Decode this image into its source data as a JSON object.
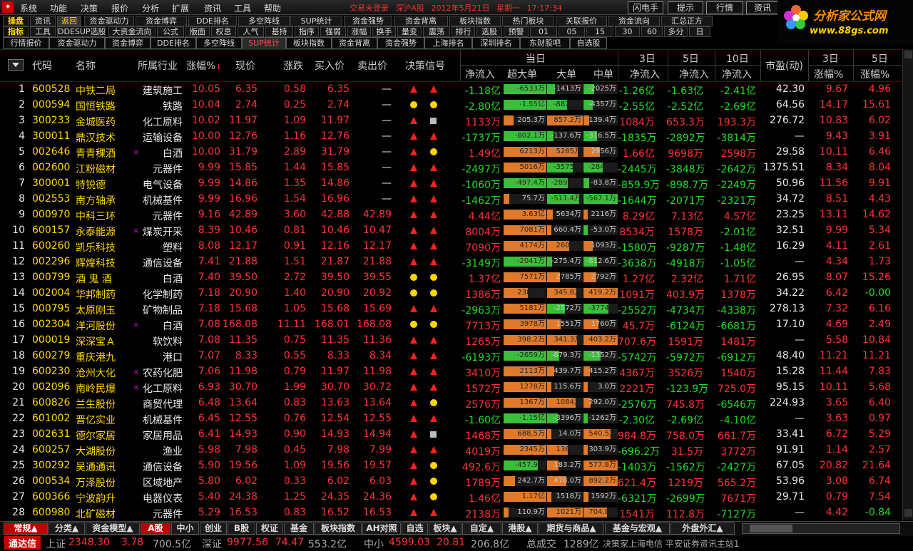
{
  "menu": [
    "系统",
    "功能",
    "决策",
    "报价",
    "分析",
    "扩展",
    "资讯",
    "工具",
    "帮助"
  ],
  "status": {
    "login": "交易未登录",
    "market": "深沪A股",
    "date": "2012年5月21日",
    "weekday": "星期一",
    "time": "17:17:34"
  },
  "top_buttons": [
    "闪电手",
    "提示",
    "行情",
    "资讯"
  ],
  "brand": {
    "name": "分析家公式网",
    "url": "www.88gs.com"
  },
  "toolbar_left": [
    [
      "操盘",
      "资讯",
      "返回"
    ],
    [
      "指标",
      "工具",
      "DDESUP选股"
    ]
  ],
  "toolbar_row1": [
    "资金驱动力",
    "资金博弈",
    "DDE排名",
    "多空阵线",
    "SUP统计",
    "资金强势",
    "资金背离",
    "板块指数",
    "热门板块",
    "关联报价",
    "资金流向",
    "汇总正方"
  ],
  "toolbar_row2": [
    "大资金流向",
    "公式",
    "版面",
    "权息",
    "人气",
    "基持",
    "指序",
    "强弱",
    "涨幅",
    "换手",
    "量变",
    "震荡",
    "排行",
    "选股",
    "预警",
    "01",
    "05",
    "15",
    "30",
    "60",
    "多分",
    "日"
  ],
  "tabs": [
    "行情报价",
    "资金驱动力",
    "资金博弈",
    "DDE排名",
    "多空阵线",
    "SUP统计",
    "板块指数",
    "资金背离",
    "资金强势",
    "上海排名",
    "深圳排名",
    "东财股吧",
    "自选股"
  ],
  "active_tab": "SUP统计",
  "header": {
    "code": "代码",
    "name": "名称",
    "industry": "所属行业",
    "chg_pct": "涨幅%",
    "price": "现价",
    "chg": "涨跌",
    "bid": "买入价",
    "ask": "卖出价",
    "signal": "决策信号",
    "today": "当日",
    "net": "净流入",
    "xl": "超大单",
    "l": "大单",
    "m": "中单",
    "d3": "3日",
    "d5": "5日",
    "d10": "10日",
    "pe": "市盈(动)",
    "d3b": "3日",
    "d5b": "5日",
    "chgpct": "涨幅%"
  },
  "rows": [
    {
      "n": "1",
      "code": "600528",
      "name": "中铁二局",
      "ind": "建筑施工",
      "x": "",
      "pct": "10.05",
      "price": "6.35",
      "chg": "0.58",
      "bid": "6.35",
      "ask": "—",
      "s1": "tri",
      "s2": "tri",
      "net": "-1.18亿",
      "xl": "-6533万",
      "l": "-1413万",
      "m": "-2025万",
      "d3": "-1.26亿",
      "d5": "-1.63亿",
      "d10": "-2.41亿",
      "pe": "42.30",
      "p3": "9.67",
      "p5": "4.96"
    },
    {
      "n": "2",
      "code": "000594",
      "name": "国恒铁路",
      "ind": "铁路",
      "x": "",
      "pct": "10.04",
      "price": "2.74",
      "chg": "0.25",
      "bid": "2.74",
      "ask": "—",
      "s1": "dot",
      "s2": "dot",
      "net": "-2.80亿",
      "xl": "-1.55亿",
      "l": "-8821万",
      "m": "-4357万",
      "d3": "-2.55亿",
      "d5": "-2.52亿",
      "d10": "-2.69亿",
      "pe": "64.56",
      "p3": "14.17",
      "p5": "15.61"
    },
    {
      "n": "3",
      "code": "300233",
      "name": "金城医药",
      "ind": "化工原料",
      "x": "",
      "pct": "10.02",
      "price": "11.97",
      "chg": "1.09",
      "bid": "11.97",
      "ask": "—",
      "s1": "tri",
      "s2": "sq",
      "net": "1133万",
      "xl": "205.3万",
      "l": "857.2万",
      "m": "139.4万",
      "d3": "1084万",
      "d5": "653.3万",
      "d10": "193.3万",
      "pe": "276.72",
      "p3": "10.83",
      "p5": "6.02"
    },
    {
      "n": "4",
      "code": "300011",
      "name": "鼎汉技术",
      "ind": "运输设备",
      "x": "",
      "pct": "10.00",
      "price": "12.76",
      "chg": "1.16",
      "bid": "12.76",
      "ask": "—",
      "s1": "tri",
      "s2": "tri",
      "net": "-1737万",
      "xl": "-802.1万",
      "l": "-137.6万",
      "m": "-316.5万",
      "d3": "-1835万",
      "d5": "-2892万",
      "d10": "-3814万",
      "pe": "—",
      "p3": "9.43",
      "p5": "3.91"
    },
    {
      "n": "5",
      "code": "002646",
      "name": "青青稞酒",
      "ind": "白酒",
      "x": "×",
      "pct": "10.00",
      "price": "31.79",
      "chg": "2.89",
      "bid": "31.79",
      "ask": "—",
      "s1": "tri",
      "s2": "dot",
      "net": "1.49亿",
      "xl": "6213万",
      "l": "5285万",
      "m": "2956万",
      "d3": "1.66亿",
      "d5": "9698万",
      "d10": "2598万",
      "pe": "29.58",
      "p3": "10.11",
      "p5": "6.46"
    },
    {
      "n": "6",
      "code": "002600",
      "name": "江粉磁材",
      "ind": "元器件",
      "x": "",
      "pct": "9.99",
      "price": "15.85",
      "chg": "1.44",
      "bid": "15.85",
      "ask": "—",
      "s1": "tri",
      "s2": "tri",
      "net": "-2497万",
      "xl": "5016万",
      "l": "-3575万",
      "m": "-2840万",
      "d3": "-2445万",
      "d5": "-3848万",
      "d10": "-2642万",
      "pe": "1375.51",
      "p3": "8.34",
      "p5": "8.04"
    },
    {
      "n": "7",
      "code": "300001",
      "name": "特锐德",
      "ind": "电气设备",
      "x": "",
      "pct": "9.99",
      "price": "14.86",
      "chg": "1.35",
      "bid": "14.86",
      "ask": "—",
      "s1": "tri",
      "s2": "tri",
      "net": "-1060万",
      "xl": "-497.4万",
      "l": "-289.3万",
      "m": "-83.8万",
      "d3": "-859.9万",
      "d5": "-898.7万",
      "d10": "-2249万",
      "pe": "50.96",
      "p3": "11.56",
      "p5": "9.91"
    },
    {
      "n": "8",
      "code": "002553",
      "name": "南方轴承",
      "ind": "机械基件",
      "x": "",
      "pct": "9.99",
      "price": "16.96",
      "chg": "1.54",
      "bid": "16.96",
      "ask": "—",
      "s1": "tri",
      "s2": "tri",
      "net": "-1462万",
      "xl": "75.7万",
      "l": "-511.4万",
      "m": "-567.1万",
      "d3": "-1644万",
      "d5": "-2071万",
      "d10": "-2321万",
      "pe": "34.72",
      "p3": "8.51",
      "p5": "4.43"
    },
    {
      "n": "9",
      "code": "000970",
      "name": "中科三环",
      "ind": "元器件",
      "x": "",
      "pct": "9.16",
      "price": "42.89",
      "chg": "3.60",
      "bid": "42.88",
      "ask": "42.89",
      "s1": "tri",
      "s2": "tri",
      "net": "4.44亿",
      "xl": "3.63亿",
      "l": "5634万",
      "m": "2116万",
      "d3": "8.29亿",
      "d5": "7.13亿",
      "d10": "4.57亿",
      "pe": "23.25",
      "p3": "13.11",
      "p5": "14.62"
    },
    {
      "n": "10",
      "code": "600157",
      "name": "永泰能源",
      "ind": "煤炭开采",
      "x": "×",
      "pct": "8.39",
      "price": "10.46",
      "chg": "0.81",
      "bid": "10.46",
      "ask": "10.47",
      "s1": "tri",
      "s2": "tri",
      "net": "8004万",
      "xl": "7081万",
      "l": "660.4万",
      "m": "-53.0万",
      "d3": "8534万",
      "d5": "1578万",
      "d10": "-2.01亿",
      "pe": "32.51",
      "p3": "9.99",
      "p5": "5.34"
    },
    {
      "n": "11",
      "code": "600260",
      "name": "凯乐科技",
      "ind": "塑料",
      "x": "",
      "pct": "8.08",
      "price": "12.17",
      "chg": "0.91",
      "bid": "12.16",
      "ask": "12.17",
      "s1": "tri",
      "s2": "tri",
      "net": "7090万",
      "xl": "4174万",
      "l": "2600万",
      "m": "1093万",
      "d3": "-1580万",
      "d5": "-9287万",
      "d10": "-1.48亿",
      "pe": "16.29",
      "p3": "4.11",
      "p5": "2.61"
    },
    {
      "n": "12",
      "code": "002296",
      "name": "辉煌科技",
      "ind": "通信设备",
      "x": "",
      "pct": "7.41",
      "price": "21.88",
      "chg": "1.51",
      "bid": "21.87",
      "ask": "21.88",
      "s1": "tri",
      "s2": "tri",
      "net": "-3149万",
      "xl": "-2041万",
      "l": "-275.4万",
      "m": "-812.6万",
      "d3": "-3638万",
      "d5": "-4918万",
      "d10": "-1.05亿",
      "pe": "—",
      "p3": "4.34",
      "p5": "1.73"
    },
    {
      "n": "13",
      "code": "000799",
      "name": "酒 鬼 酒",
      "ind": "白酒",
      "x": "",
      "pct": "7.40",
      "price": "39.50",
      "chg": "2.72",
      "bid": "39.50",
      "ask": "39.55",
      "s1": "dot",
      "s2": "dot",
      "net": "1.37亿",
      "xl": "7571万",
      "l": "2785万",
      "m": "2792万",
      "d3": "1.27亿",
      "d5": "2.32亿",
      "d10": "1.71亿",
      "pe": "26.95",
      "p3": "8.07",
      "p5": "15.26"
    },
    {
      "n": "14",
      "code": "002004",
      "name": "华邦制药",
      "ind": "化学制药",
      "x": "",
      "pct": "7.18",
      "price": "20.90",
      "chg": "1.40",
      "bid": "20.90",
      "ask": "20.92",
      "s1": "dot",
      "s2": "dot",
      "net": "1386万",
      "xl": "238.9万",
      "l": "345.8万",
      "m": "419.2万",
      "d3": "1091万",
      "d5": "403.9万",
      "d10": "1378万",
      "pe": "34.22",
      "p3": "6.42",
      "p5": "-0.00"
    },
    {
      "n": "15",
      "code": "000795",
      "name": "太原刚玉",
      "ind": "矿物制品",
      "x": "",
      "pct": "7.18",
      "price": "15.68",
      "chg": "1.05",
      "bid": "15.68",
      "ask": "15.69",
      "s1": "tri",
      "s2": "tri",
      "net": "-2963万",
      "xl": "5181万",
      "l": "-2572万",
      "m": "-3774万",
      "d3": "-2552万",
      "d5": "-4734万",
      "d10": "-4338万",
      "pe": "278.13",
      "p3": "7.32",
      "p5": "6.16"
    },
    {
      "n": "16",
      "code": "002304",
      "name": "洋河股份",
      "ind": "白酒",
      "x": "×",
      "pct": "7.08",
      "price": "168.08",
      "chg": "11.11",
      "bid": "168.01",
      "ask": "168.08",
      "s1": "dot",
      "s2": "dot",
      "net": "7713万",
      "xl": "3978万",
      "l": "1551万",
      "m": "1760万",
      "d3": "45.7万",
      "d5": "-6124万",
      "d10": "-6681万",
      "pe": "17.10",
      "p3": "4.69",
      "p5": "2.49"
    },
    {
      "n": "17",
      "code": "000019",
      "name": "深深宝Ａ",
      "ind": "软饮料",
      "x": "",
      "pct": "7.08",
      "price": "11.35",
      "chg": "0.75",
      "bid": "11.35",
      "ask": "11.36",
      "s1": "tri",
      "s2": "tri",
      "net": "1265万",
      "xl": "398.2万",
      "l": "341.3万",
      "m": "403.2万",
      "d3": "707.6万",
      "d5": "1591万",
      "d10": "1481万",
      "pe": "—",
      "p3": "5.58",
      "p5": "10.84"
    },
    {
      "n": "18",
      "code": "600279",
      "name": "重庆港九",
      "ind": "港口",
      "x": "",
      "pct": "7.07",
      "price": "8.33",
      "chg": "0.55",
      "bid": "8.33",
      "ask": "8.34",
      "s1": "tri",
      "s2": "tri",
      "net": "-6193万",
      "xl": "-2659万",
      "l": "-879.3万",
      "m": "-1352万",
      "d3": "-5742万",
      "d5": "-5972万",
      "d10": "-6912万",
      "pe": "48.40",
      "p3": "11.21",
      "p5": "11.21"
    },
    {
      "n": "19",
      "code": "600230",
      "name": "沧州大化",
      "ind": "农药化肥",
      "x": "×",
      "pct": "7.06",
      "price": "11.98",
      "chg": "0.79",
      "bid": "11.97",
      "ask": "11.98",
      "s1": "tri",
      "s2": "tri",
      "net": "3410万",
      "xl": "2113万",
      "l": "439.7万",
      "m": "415.2万",
      "d3": "4367万",
      "d5": "3526万",
      "d10": "1540万",
      "pe": "15.28",
      "p3": "11.44",
      "p5": "7.83"
    },
    {
      "n": "20",
      "code": "002096",
      "name": "南岭民爆",
      "ind": "化工原料",
      "x": "×",
      "pct": "6.93",
      "price": "30.70",
      "chg": "1.99",
      "bid": "30.70",
      "ask": "30.72",
      "s1": "tri",
      "s2": "tri",
      "net": "1572万",
      "xl": "1278万",
      "l": "115.6万",
      "m": "3.0万",
      "d3": "2221万",
      "d5": "-123.9万",
      "d10": "725.0万",
      "pe": "95.15",
      "p3": "10.11",
      "p5": "5.68"
    },
    {
      "n": "21",
      "code": "600826",
      "name": "兰生股份",
      "ind": "商贸代理",
      "x": "",
      "pct": "6.48",
      "price": "13.64",
      "chg": "0.83",
      "bid": "13.63",
      "ask": "13.64",
      "s1": "tri",
      "s2": "dot",
      "net": "2576万",
      "xl": "1367万",
      "l": "1084万",
      "m": "292.0万",
      "d3": "-2576万",
      "d5": "745.8万",
      "d10": "-6546万",
      "pe": "224.93",
      "p3": "3.65",
      "p5": "6.40"
    },
    {
      "n": "22",
      "code": "601002",
      "name": "晋亿实业",
      "ind": "机械基件",
      "x": "",
      "pct": "6.45",
      "price": "12.55",
      "chg": "0.76",
      "bid": "12.54",
      "ask": "12.55",
      "s1": "tri",
      "s2": "tri",
      "net": "-1.60亿",
      "xl": "-1.15亿",
      "l": "-3396万",
      "m": "-1262万",
      "d3": "-2.30亿",
      "d5": "-2.69亿",
      "d10": "-4.10亿",
      "pe": "—",
      "p3": "3.63",
      "p5": "0.97"
    },
    {
      "n": "23",
      "code": "002631",
      "name": "德尔家居",
      "ind": "家居用品",
      "x": "",
      "pct": "6.41",
      "price": "14.93",
      "chg": "0.90",
      "bid": "14.93",
      "ask": "14.94",
      "s1": "tri",
      "s2": "sq",
      "net": "1468万",
      "xl": "688.5万",
      "l": "14.0万",
      "m": "540.5万",
      "d3": "984.8万",
      "d5": "758.0万",
      "d10": "661.7万",
      "pe": "33.41",
      "p3": "6.72",
      "p5": "5.29"
    },
    {
      "n": "24",
      "code": "600257",
      "name": "大湖股份",
      "ind": "渔业",
      "x": "",
      "pct": "5.98",
      "price": "7.98",
      "chg": "0.45",
      "bid": "7.98",
      "ask": "7.99",
      "s1": "tri",
      "s2": "tri",
      "net": "4019万",
      "xl": "2345万",
      "l": "1360万",
      "m": "303.9万",
      "d3": "-696.2万",
      "d5": "31.5万",
      "d10": "3772万",
      "pe": "91.91",
      "p3": "1.14",
      "p5": "2.57"
    },
    {
      "n": "25",
      "code": "300292",
      "name": "吴通通讯",
      "ind": "通信设备",
      "x": "",
      "pct": "5.90",
      "price": "19.56",
      "chg": "1.09",
      "bid": "19.56",
      "ask": "19.57",
      "s1": "tri",
      "s2": "dot",
      "net": "492.6万",
      "xl": "-457.9万",
      "l": "183.2万",
      "m": "577.8万",
      "d3": "-1403万",
      "d5": "-1562万",
      "d10": "-2427万",
      "pe": "67.05",
      "p3": "20.82",
      "p5": "21.64"
    },
    {
      "n": "26",
      "code": "000534",
      "name": "万泽股份",
      "ind": "区域地产",
      "x": "",
      "pct": "5.80",
      "price": "6.02",
      "chg": "0.33",
      "bid": "6.02",
      "ask": "6.03",
      "s1": "tri",
      "s2": "dot",
      "net": "1789万",
      "xl": "242.7万",
      "l": "478.0万",
      "m": "892.2万",
      "d3": "621.4万",
      "d5": "1219万",
      "d10": "565.2万",
      "pe": "53.96",
      "p3": "3.08",
      "p5": "6.74"
    },
    {
      "n": "27",
      "code": "600366",
      "name": "宁波韵升",
      "ind": "电器仪表",
      "x": "",
      "pct": "5.40",
      "price": "24.38",
      "chg": "1.25",
      "bid": "24.35",
      "ask": "24.36",
      "s1": "tri",
      "s2": "dot",
      "net": "1.46亿",
      "xl": "1.17亿",
      "l": "1518万",
      "m": "1592万",
      "d3": "-6321万",
      "d5": "-2699万",
      "d10": "7671万",
      "pe": "29.71",
      "p3": "0.79",
      "p5": "7.54"
    },
    {
      "n": "28",
      "code": "600980",
      "name": "北矿磁材",
      "ind": "元器件",
      "x": "",
      "pct": "5.29",
      "price": "16.53",
      "chg": "0.83",
      "bid": "16.52",
      "ask": "16.53",
      "s1": "tri",
      "s2": "tri",
      "net": "2138万",
      "xl": "110.9万",
      "l": "1021万",
      "m": "704.8万",
      "d3": "1541万",
      "d5": "112.8万",
      "d10": "-7127万",
      "pe": "—",
      "p3": "4.42",
      "p5": "-0.84"
    }
  ],
  "bottom_tabs": [
    "常规▲",
    "分类▲",
    "资金模型▲",
    "A股",
    "中小",
    "创业",
    "B股",
    "权证",
    "基金",
    "板块指数",
    "AH对照",
    "自选",
    "板块▲",
    "自定▲",
    "港股▲",
    "期货与商品▲",
    "基金与宏观▲",
    "外盘外汇▲"
  ],
  "active_bottom_tab": "A股",
  "index_bar": {
    "label": "通达信",
    "sh_name": "上证",
    "sh_val": "2348.30",
    "sh_chg": "3.78",
    "sh_vol": "700.5亿",
    "sz_name": "深证",
    "sz_val": "9977.56",
    "sz_chg": "74.47",
    "sz_vol": "553.2亿",
    "zx_name": "中小",
    "zx_val": "4599.03",
    "zx_chg": "20.81",
    "zx_vol": "206.8亿",
    "total_label": "总成交",
    "total_val": "1289亿",
    "news": "决策家上海电信 平安证券资讯主站1"
  }
}
